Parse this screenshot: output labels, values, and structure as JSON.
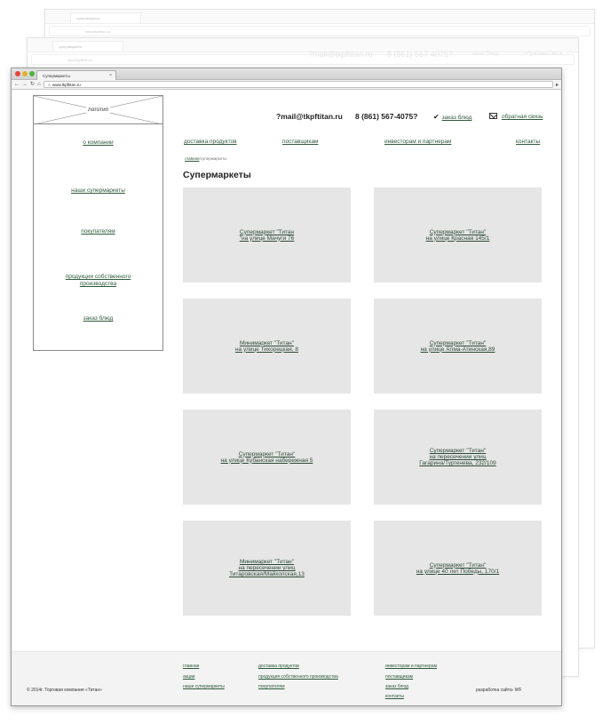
{
  "ghosts": {
    "back_tab": "супермаркеты",
    "back_address": "www.tkpftitan.ru",
    "mid_tab": "супермаркеты",
    "mid_address": "www.tkpftitan.ru",
    "mid_mail": "?mail@tkpftitan.ru",
    "mid_phone": "8 (861) 567-4075?",
    "mid_order": "заказ блюд",
    "mid_feedback": "обратная связь"
  },
  "browser": {
    "tab_title": "Супермаркеты",
    "address": "www.tkpftitan.ru",
    "traffic_colors": [
      "#e2463f",
      "#e0b12c",
      "#4fb23b"
    ]
  },
  "sidebar": {
    "logo": "логотип",
    "items": [
      {
        "label": "о компании"
      },
      {
        "label": "наши супермаркеты"
      },
      {
        "label": "покупателям"
      },
      {
        "label": "продукция собственного\nпроизводства"
      },
      {
        "label": "заказ блюд"
      }
    ]
  },
  "header": {
    "mail": "?mail@tkpftitan.ru",
    "phone": "8 (861) 567-4075?",
    "order": "заказ блюд",
    "feedback": "обратная связь"
  },
  "nav": {
    "items": [
      {
        "label": "доставка продуктов"
      },
      {
        "label": "поставщикам"
      },
      {
        "label": "инвесторам и партнерам"
      },
      {
        "label": "контакты"
      }
    ]
  },
  "breadcrumb": {
    "home": "главная",
    "sep": "/",
    "current": "супермаркеты"
  },
  "page_title": "Супермаркеты",
  "stores": [
    {
      "label": "Супермаркет \"Титан\n\"на улице Мачуги 76"
    },
    {
      "label": "Супермаркет \"Титан\"\nна улице Красная 145/1"
    },
    {
      "label": "Минимаркет \"Титан\"\nна улице Тихорецкая, 8"
    },
    {
      "label": "Супермаркет \"Титан\"\nна улице Алма-Атинская,89"
    },
    {
      "label": "Супермаркет \"Титан\"\nна улице Кубанская набережная 5"
    },
    {
      "label": "Супермаркет \"Титан\"\nна пересечении улиц\nГагарина/Тургенева, 232/109"
    },
    {
      "label": "Минимаркет \"Титан\"\nна пересечении улиц\nТитаровская/Майкопская,13"
    },
    {
      "label": "Супермаркет \"Титан\"\nна улице 40 лет Победы, 170/1"
    }
  ],
  "footer": {
    "col1": [
      "главная",
      "акции",
      "наши супермаркеты"
    ],
    "col2": [
      "доставка продуктов",
      "продукция собственного производства",
      "покупателям"
    ],
    "col3": [
      "инвесторам и партнерам",
      "поставщикам",
      "заказ блюд",
      "контакты"
    ],
    "copyright": "© 2014г. Торговая компания «Титан»",
    "developer": "разработка сайта- WF"
  }
}
